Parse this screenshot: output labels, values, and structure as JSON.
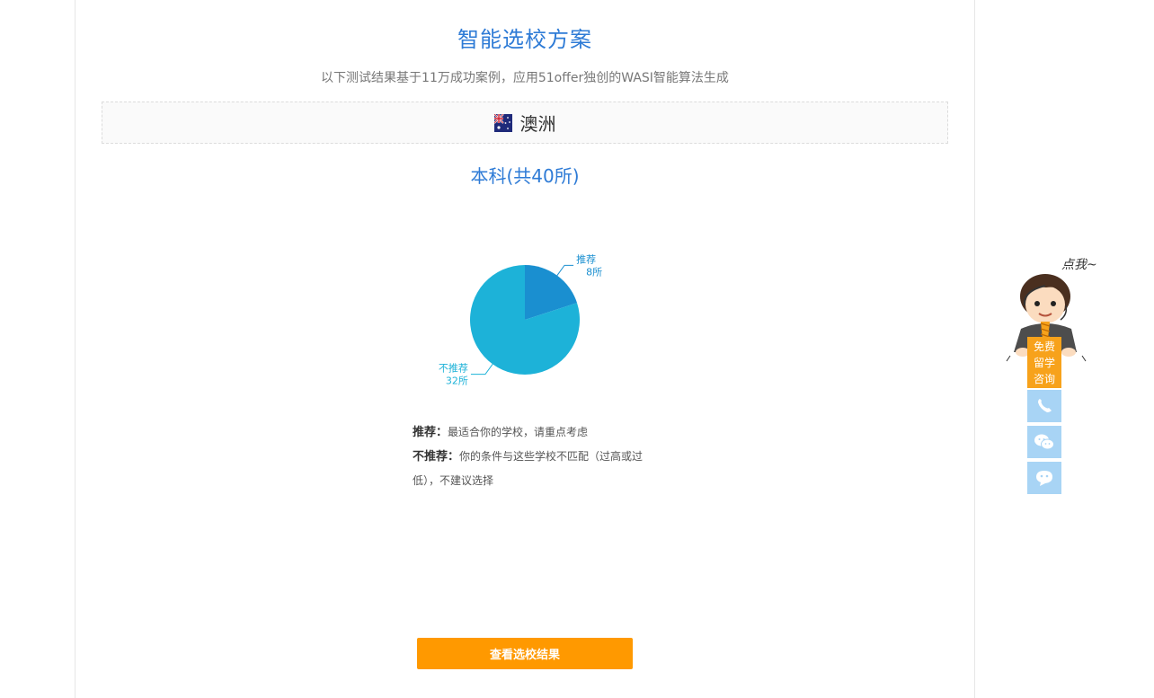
{
  "header": {
    "title": "智能选校方案",
    "subtitle": "以下测试结果基于11万成功案例，应用51offer独创的WASI智能算法生成"
  },
  "country": {
    "name": "澳洲",
    "flag_icon": "australia-flag-icon"
  },
  "level": {
    "title": "本科(共40所)"
  },
  "chart_data": {
    "type": "pie",
    "categories": [
      "推荐",
      "不推荐"
    ],
    "values": [
      8,
      32
    ],
    "value_labels": [
      "8所",
      "32所"
    ],
    "colors": [
      "#1a8fd0",
      "#1db2d8"
    ]
  },
  "legend": {
    "recommend_term": "推荐：",
    "recommend_desc": "最适合你的学校，请重点考虑",
    "not_recommend_term": "不推荐：",
    "not_recommend_desc": "你的条件与这些学校不匹配（过高或过低），不建议选择"
  },
  "cta": {
    "label": "查看选校结果"
  },
  "float_widget": {
    "bubble_text": "点我~",
    "consult_label": "免费留学咨询",
    "phone_icon": "phone-icon",
    "wechat_icon": "wechat-icon",
    "chat_icon": "chat-icon",
    "colors": {
      "consult": "#f7a21b",
      "icon_bg": "#a8d4f5"
    }
  }
}
